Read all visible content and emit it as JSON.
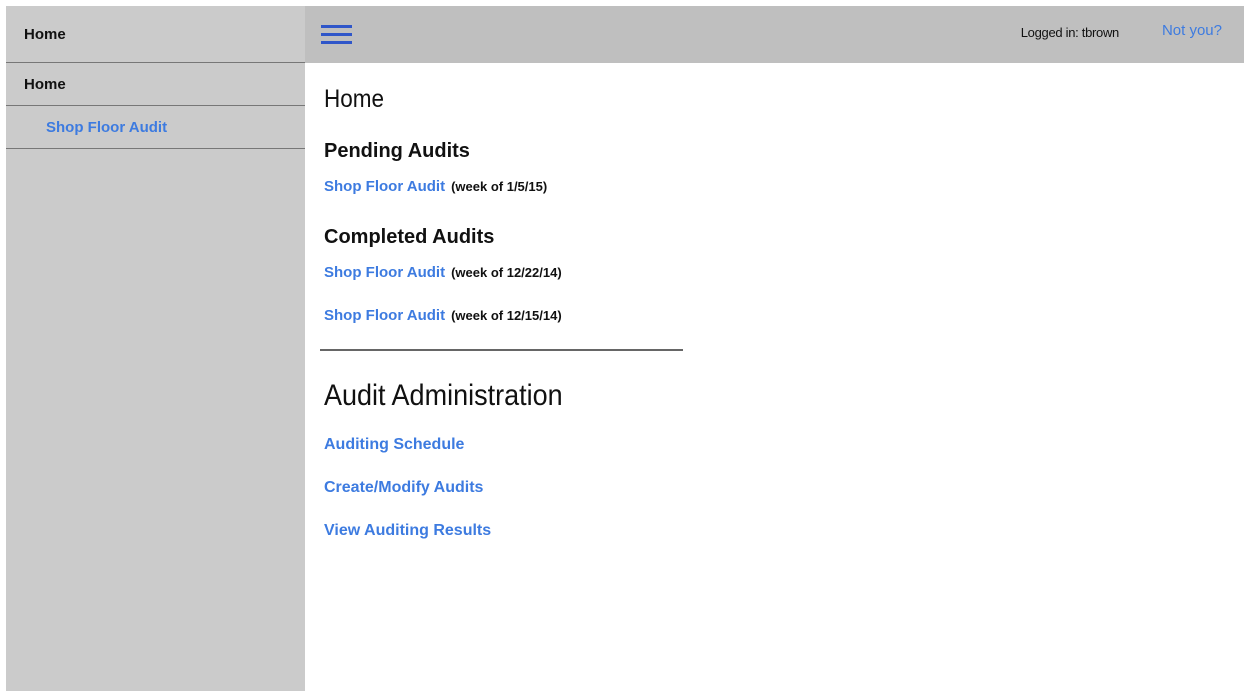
{
  "sidebar": {
    "header": "Home",
    "items": [
      {
        "label": "Home"
      },
      {
        "label": "Shop Floor Audit"
      }
    ]
  },
  "topbar": {
    "menu_icon": "hamburger-menu-icon",
    "logged_in_text": "Logged in: tbrown",
    "not_you_label": "Not you?"
  },
  "main": {
    "title": "Home",
    "pending": {
      "heading": "Pending Audits",
      "items": [
        {
          "link": "Shop Floor Audit",
          "week": "(week of 1/5/15)"
        }
      ]
    },
    "completed": {
      "heading": "Completed Audits",
      "items": [
        {
          "link": "Shop Floor Audit",
          "week": "(week of 12/22/14)"
        },
        {
          "link": "Shop Floor Audit",
          "week": "(week of 12/15/14)"
        }
      ]
    },
    "admin": {
      "heading": "Audit Administration",
      "links": [
        {
          "label": "Auditing Schedule"
        },
        {
          "label": "Create/Modify Audits"
        },
        {
          "label": "View Auditing Results"
        }
      ]
    }
  },
  "colors": {
    "link": "#3d7be0",
    "sidebar_bg": "#cbcbcb",
    "topbar_bg": "#bfbfbf",
    "menu_icon": "#2f56c9"
  }
}
